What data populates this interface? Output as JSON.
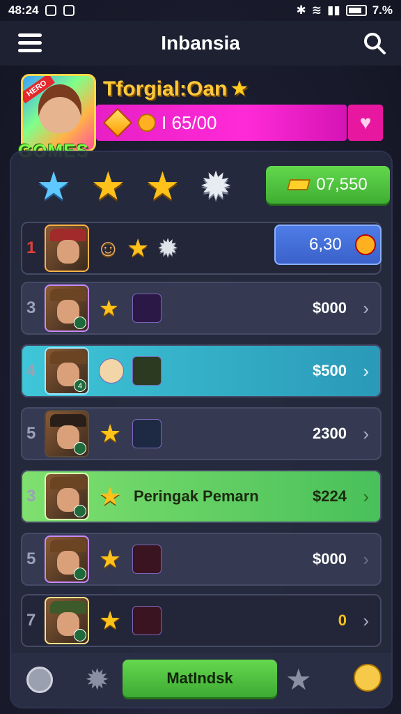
{
  "statusbar": {
    "time": "48:24",
    "battery": "7.%"
  },
  "appbar": {
    "title": "Inbansia"
  },
  "profile": {
    "hero_tag": "HERO",
    "games_label": "GOMES",
    "name": "Tforgial:Oan",
    "currency": "I 65/00"
  },
  "top_button": {
    "value": "07,550"
  },
  "rows": [
    {
      "rank": "1",
      "value": "6,30"
    },
    {
      "rank": "3",
      "value": "$000"
    },
    {
      "rank": "4",
      "value": "$500"
    },
    {
      "rank": "5",
      "value": "2300"
    },
    {
      "rank": "3",
      "label": "Peringak Pemarn",
      "value": "$224"
    },
    {
      "rank": "5",
      "value": "$000"
    },
    {
      "rank": "7",
      "value": "0"
    }
  ],
  "bottom": {
    "main_button": "MatIndsk"
  },
  "colors": {
    "accent_green": "#4cc63f",
    "pink_bar": "#ff2ad7",
    "highlight_teal": "#3fc6d8"
  }
}
